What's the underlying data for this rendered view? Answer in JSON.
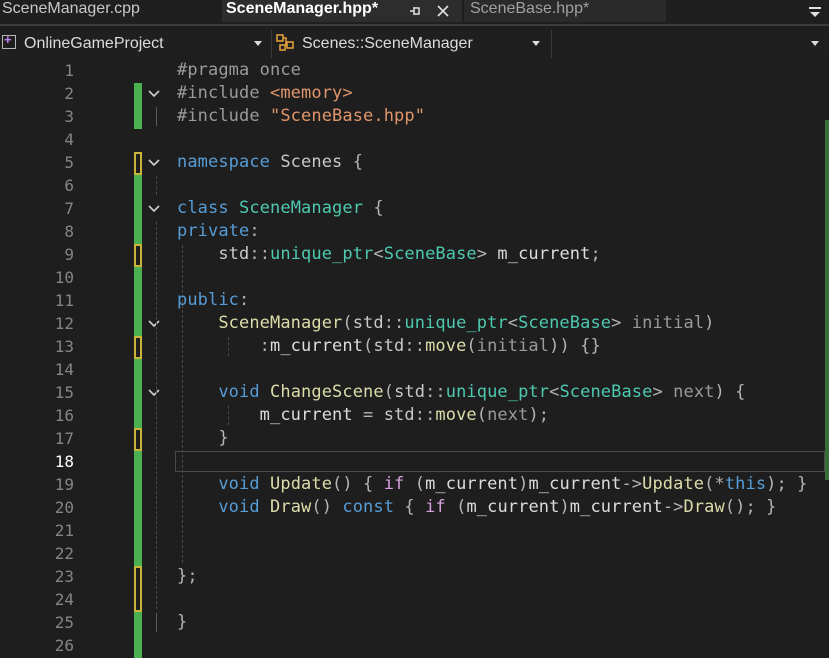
{
  "tabs": [
    {
      "label": "SceneManager.cpp",
      "state": "inactive"
    },
    {
      "label": "SceneManager.hpp*",
      "state": "active",
      "pin_icon": "pin-icon",
      "close_icon": "close-icon"
    },
    {
      "label": "SceneBase.hpp*",
      "state": "preview"
    }
  ],
  "navbar": {
    "project": "OnlineGameProject",
    "scope": "Scenes::SceneManager",
    "member": ""
  },
  "editor": {
    "current_line": 18,
    "line_numbers": [
      "1",
      "2",
      "3",
      "4",
      "5",
      "6",
      "7",
      "8",
      "9",
      "10",
      "11",
      "12",
      "13",
      "14",
      "15",
      "16",
      "17",
      "18",
      "19",
      "20",
      "21",
      "22",
      "23",
      "24",
      "25",
      "26"
    ],
    "lines": [
      [
        {
          "t": "#pragma once",
          "c": "pp"
        }
      ],
      [
        {
          "t": "#include ",
          "c": "pp"
        },
        {
          "t": "<memory>",
          "c": "str"
        }
      ],
      [
        {
          "t": "#include ",
          "c": "pp"
        },
        {
          "t": "\"SceneBase.hpp\"",
          "c": "str"
        }
      ],
      [],
      [
        {
          "t": "namespace",
          "c": "kw"
        },
        {
          "t": " Scenes ",
          "c": "ns"
        },
        {
          "t": "{",
          "c": "punc"
        }
      ],
      [],
      [
        {
          "t": "class",
          "c": "kw"
        },
        {
          "t": " ",
          "c": "var"
        },
        {
          "t": "SceneManager",
          "c": "type"
        },
        {
          "t": " {",
          "c": "punc"
        }
      ],
      [
        {
          "t": "private",
          "c": "kw"
        },
        {
          "t": ":",
          "c": "punc"
        }
      ],
      [
        {
          "t": "    std",
          "c": "ns"
        },
        {
          "t": "::",
          "c": "op"
        },
        {
          "t": "unique_ptr",
          "c": "type"
        },
        {
          "t": "<",
          "c": "op"
        },
        {
          "t": "SceneBase",
          "c": "type"
        },
        {
          "t": ">",
          "c": "op"
        },
        {
          "t": " m_current",
          "c": "var"
        },
        {
          "t": ";",
          "c": "punc"
        }
      ],
      [],
      [
        {
          "t": "public",
          "c": "kw"
        },
        {
          "t": ":",
          "c": "punc"
        }
      ],
      [
        {
          "t": "    SceneManager",
          "c": "fn"
        },
        {
          "t": "(",
          "c": "punc"
        },
        {
          "t": "std",
          "c": "ns"
        },
        {
          "t": "::",
          "c": "op"
        },
        {
          "t": "unique_ptr",
          "c": "type"
        },
        {
          "t": "<",
          "c": "op"
        },
        {
          "t": "SceneBase",
          "c": "type"
        },
        {
          "t": ">",
          "c": "op"
        },
        {
          "t": " initial",
          "c": "param"
        },
        {
          "t": ")",
          "c": "punc"
        }
      ],
      [
        {
          "t": "        :",
          "c": "punc"
        },
        {
          "t": "m_current",
          "c": "var"
        },
        {
          "t": "(",
          "c": "punc"
        },
        {
          "t": "std",
          "c": "ns"
        },
        {
          "t": "::",
          "c": "op"
        },
        {
          "t": "move",
          "c": "fn"
        },
        {
          "t": "(",
          "c": "punc"
        },
        {
          "t": "initial",
          "c": "param"
        },
        {
          "t": ")) {}",
          "c": "punc"
        }
      ],
      [],
      [
        {
          "t": "    void",
          "c": "kw"
        },
        {
          "t": " ChangeScene",
          "c": "fn"
        },
        {
          "t": "(",
          "c": "punc"
        },
        {
          "t": "std",
          "c": "ns"
        },
        {
          "t": "::",
          "c": "op"
        },
        {
          "t": "unique_ptr",
          "c": "type"
        },
        {
          "t": "<",
          "c": "op"
        },
        {
          "t": "SceneBase",
          "c": "type"
        },
        {
          "t": ">",
          "c": "op"
        },
        {
          "t": " next",
          "c": "param"
        },
        {
          "t": ") {",
          "c": "punc"
        }
      ],
      [
        {
          "t": "        m_current",
          "c": "var"
        },
        {
          "t": " = ",
          "c": "op"
        },
        {
          "t": "std",
          "c": "ns"
        },
        {
          "t": "::",
          "c": "op"
        },
        {
          "t": "move",
          "c": "fn"
        },
        {
          "t": "(",
          "c": "punc"
        },
        {
          "t": "next",
          "c": "param"
        },
        {
          "t": ");",
          "c": "punc"
        }
      ],
      [
        {
          "t": "    }",
          "c": "punc"
        }
      ],
      [],
      [
        {
          "t": "    void",
          "c": "kw"
        },
        {
          "t": " Update",
          "c": "fn"
        },
        {
          "t": "() { ",
          "c": "punc"
        },
        {
          "t": "if",
          "c": "ctl"
        },
        {
          "t": " (",
          "c": "punc"
        },
        {
          "t": "m_current",
          "c": "var"
        },
        {
          "t": ")",
          "c": "punc"
        },
        {
          "t": "m_current",
          "c": "var"
        },
        {
          "t": "->",
          "c": "op"
        },
        {
          "t": "Update",
          "c": "fn"
        },
        {
          "t": "(*",
          "c": "punc"
        },
        {
          "t": "this",
          "c": "kw"
        },
        {
          "t": "); }",
          "c": "punc"
        }
      ],
      [
        {
          "t": "    void",
          "c": "kw"
        },
        {
          "t": " Draw",
          "c": "fn"
        },
        {
          "t": "() ",
          "c": "punc"
        },
        {
          "t": "const",
          "c": "kw"
        },
        {
          "t": " { ",
          "c": "punc"
        },
        {
          "t": "if",
          "c": "ctl"
        },
        {
          "t": " (",
          "c": "punc"
        },
        {
          "t": "m_current",
          "c": "var"
        },
        {
          "t": ")",
          "c": "punc"
        },
        {
          "t": "m_current",
          "c": "var"
        },
        {
          "t": "->",
          "c": "op"
        },
        {
          "t": "Draw",
          "c": "fn"
        },
        {
          "t": "(); }",
          "c": "punc"
        }
      ],
      [],
      [],
      [
        {
          "t": "};",
          "c": "punc"
        }
      ],
      [],
      [
        {
          "t": "}",
          "c": "punc"
        }
      ],
      []
    ],
    "fold_lines": [
      2,
      5,
      7,
      12,
      15
    ],
    "colors": {
      "background": "#1e1e1e",
      "saved_change": "#4caf50",
      "unsaved_change": "#c9b53a",
      "line_number": "#858585",
      "current_line_number": "#ffffff"
    }
  }
}
